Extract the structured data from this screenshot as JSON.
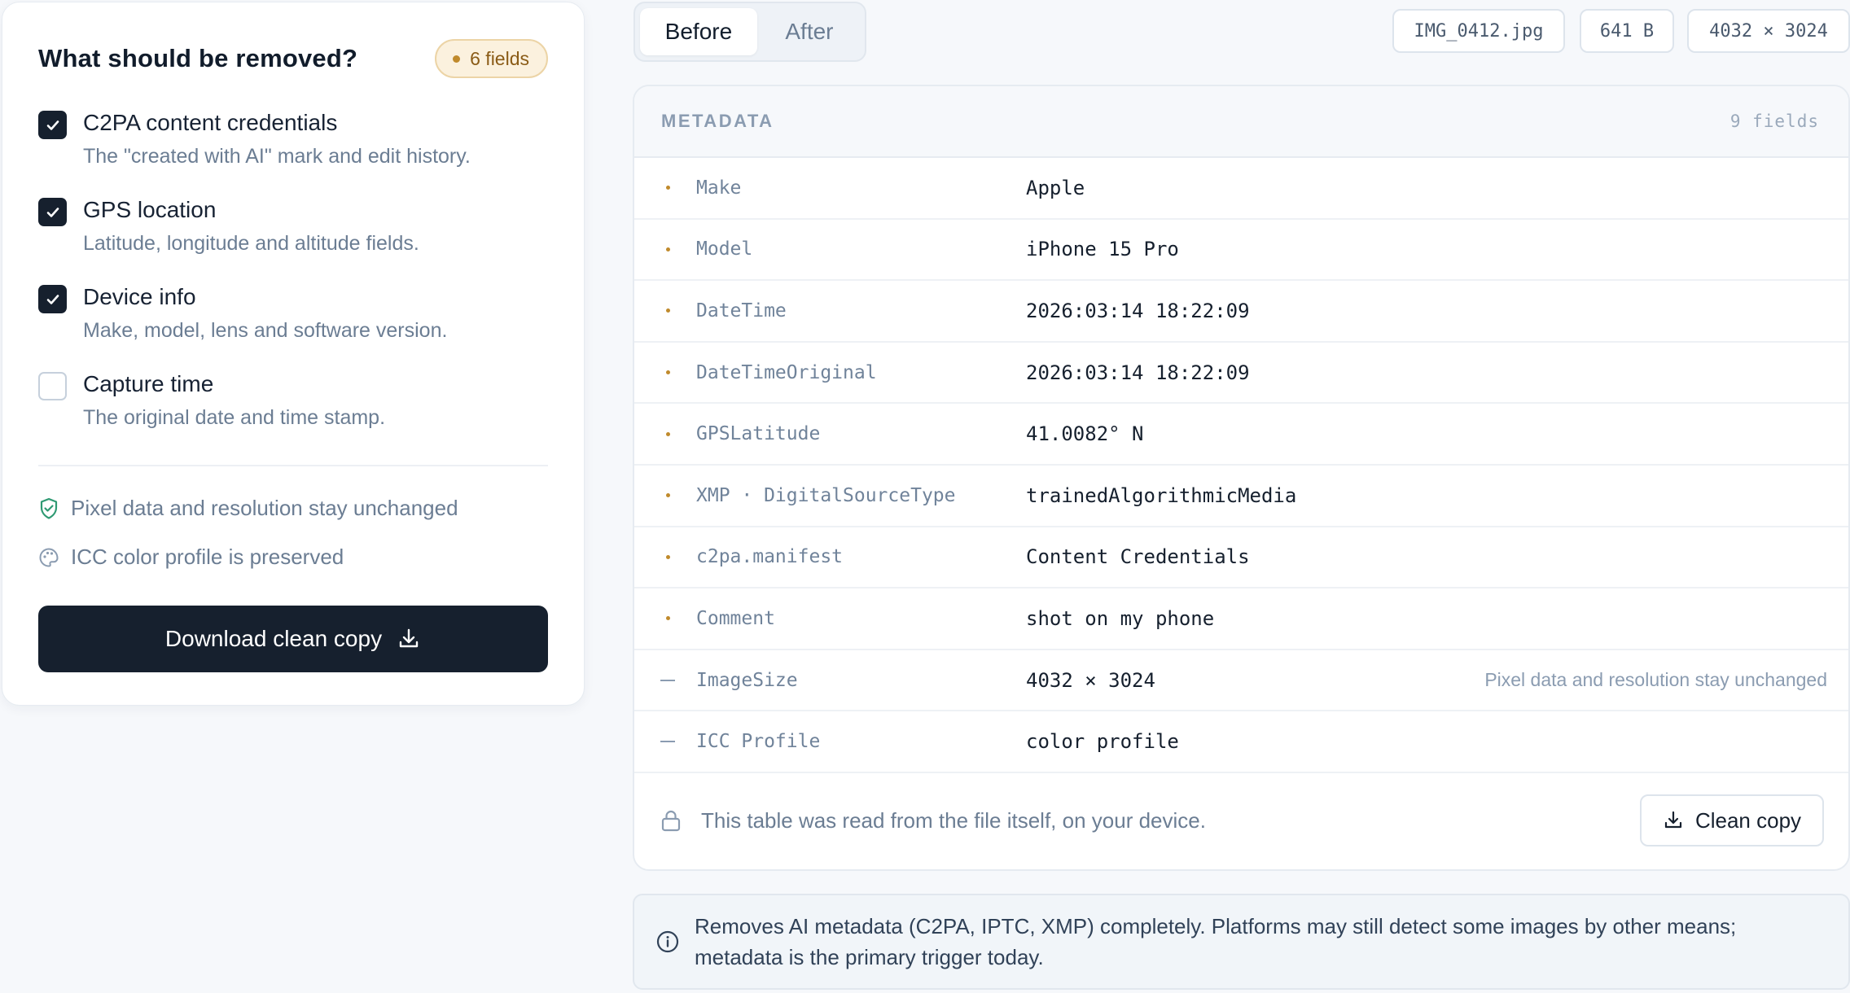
{
  "panel": {
    "title": "What should be removed?",
    "badge": "6 fields",
    "options": [
      {
        "label": "C2PA content credentials",
        "desc": "The \"created with AI\" mark and edit history.",
        "checked": true
      },
      {
        "label": "GPS location",
        "desc": "Latitude, longitude and altitude fields.",
        "checked": true
      },
      {
        "label": "Device info",
        "desc": "Make, model, lens and software version.",
        "checked": true
      },
      {
        "label": "Capture time",
        "desc": "The original date and time stamp.",
        "checked": false
      }
    ],
    "notes": {
      "pixels": "Pixel data and resolution stay unchanged",
      "icc": "ICC color profile is preserved"
    },
    "download_label": "Download clean copy"
  },
  "tabs": {
    "before": "Before",
    "after": "After",
    "active": "before"
  },
  "file": {
    "name": "IMG_0412.jpg",
    "size": "641 B",
    "dimensions": "4032 × 3024"
  },
  "metadata": {
    "title": "METADATA",
    "count": "9 fields",
    "rows": [
      {
        "key": "Make",
        "value": "Apple",
        "marker": "dot",
        "note": ""
      },
      {
        "key": "Model",
        "value": "iPhone 15 Pro",
        "marker": "dot",
        "note": ""
      },
      {
        "key": "DateTime",
        "value": "2026:03:14 18:22:09",
        "marker": "dot",
        "note": ""
      },
      {
        "key": "DateTimeOriginal",
        "value": "2026:03:14 18:22:09",
        "marker": "dot",
        "note": ""
      },
      {
        "key": "GPSLatitude",
        "value": "41.0082° N",
        "marker": "dot",
        "note": ""
      },
      {
        "key": "XMP · DigitalSourceType",
        "value": "trainedAlgorithmicMedia",
        "marker": "dot",
        "note": ""
      },
      {
        "key": "c2pa.manifest",
        "value": "Content Credentials",
        "marker": "dot",
        "note": ""
      },
      {
        "key": "Comment",
        "value": "shot on my phone",
        "marker": "dot",
        "note": ""
      },
      {
        "key": "ImageSize",
        "value": "4032 × 3024",
        "marker": "dash",
        "note": "Pixel data and resolution stay unchanged"
      },
      {
        "key": "ICC Profile",
        "value": "color profile",
        "marker": "dash",
        "note": ""
      }
    ],
    "footer_text": "This table was read from the file itself, on your device.",
    "clean_label": "Clean copy"
  },
  "info": "Removes AI metadata (C2PA, IPTC, XMP) completely. Platforms may still detect some images by other means; metadata is the primary trigger today.",
  "colors": {
    "accent": "#16202e",
    "badge_bg": "#fbf1de",
    "marker": "#c08a2c",
    "muted": "#6b7d93"
  }
}
